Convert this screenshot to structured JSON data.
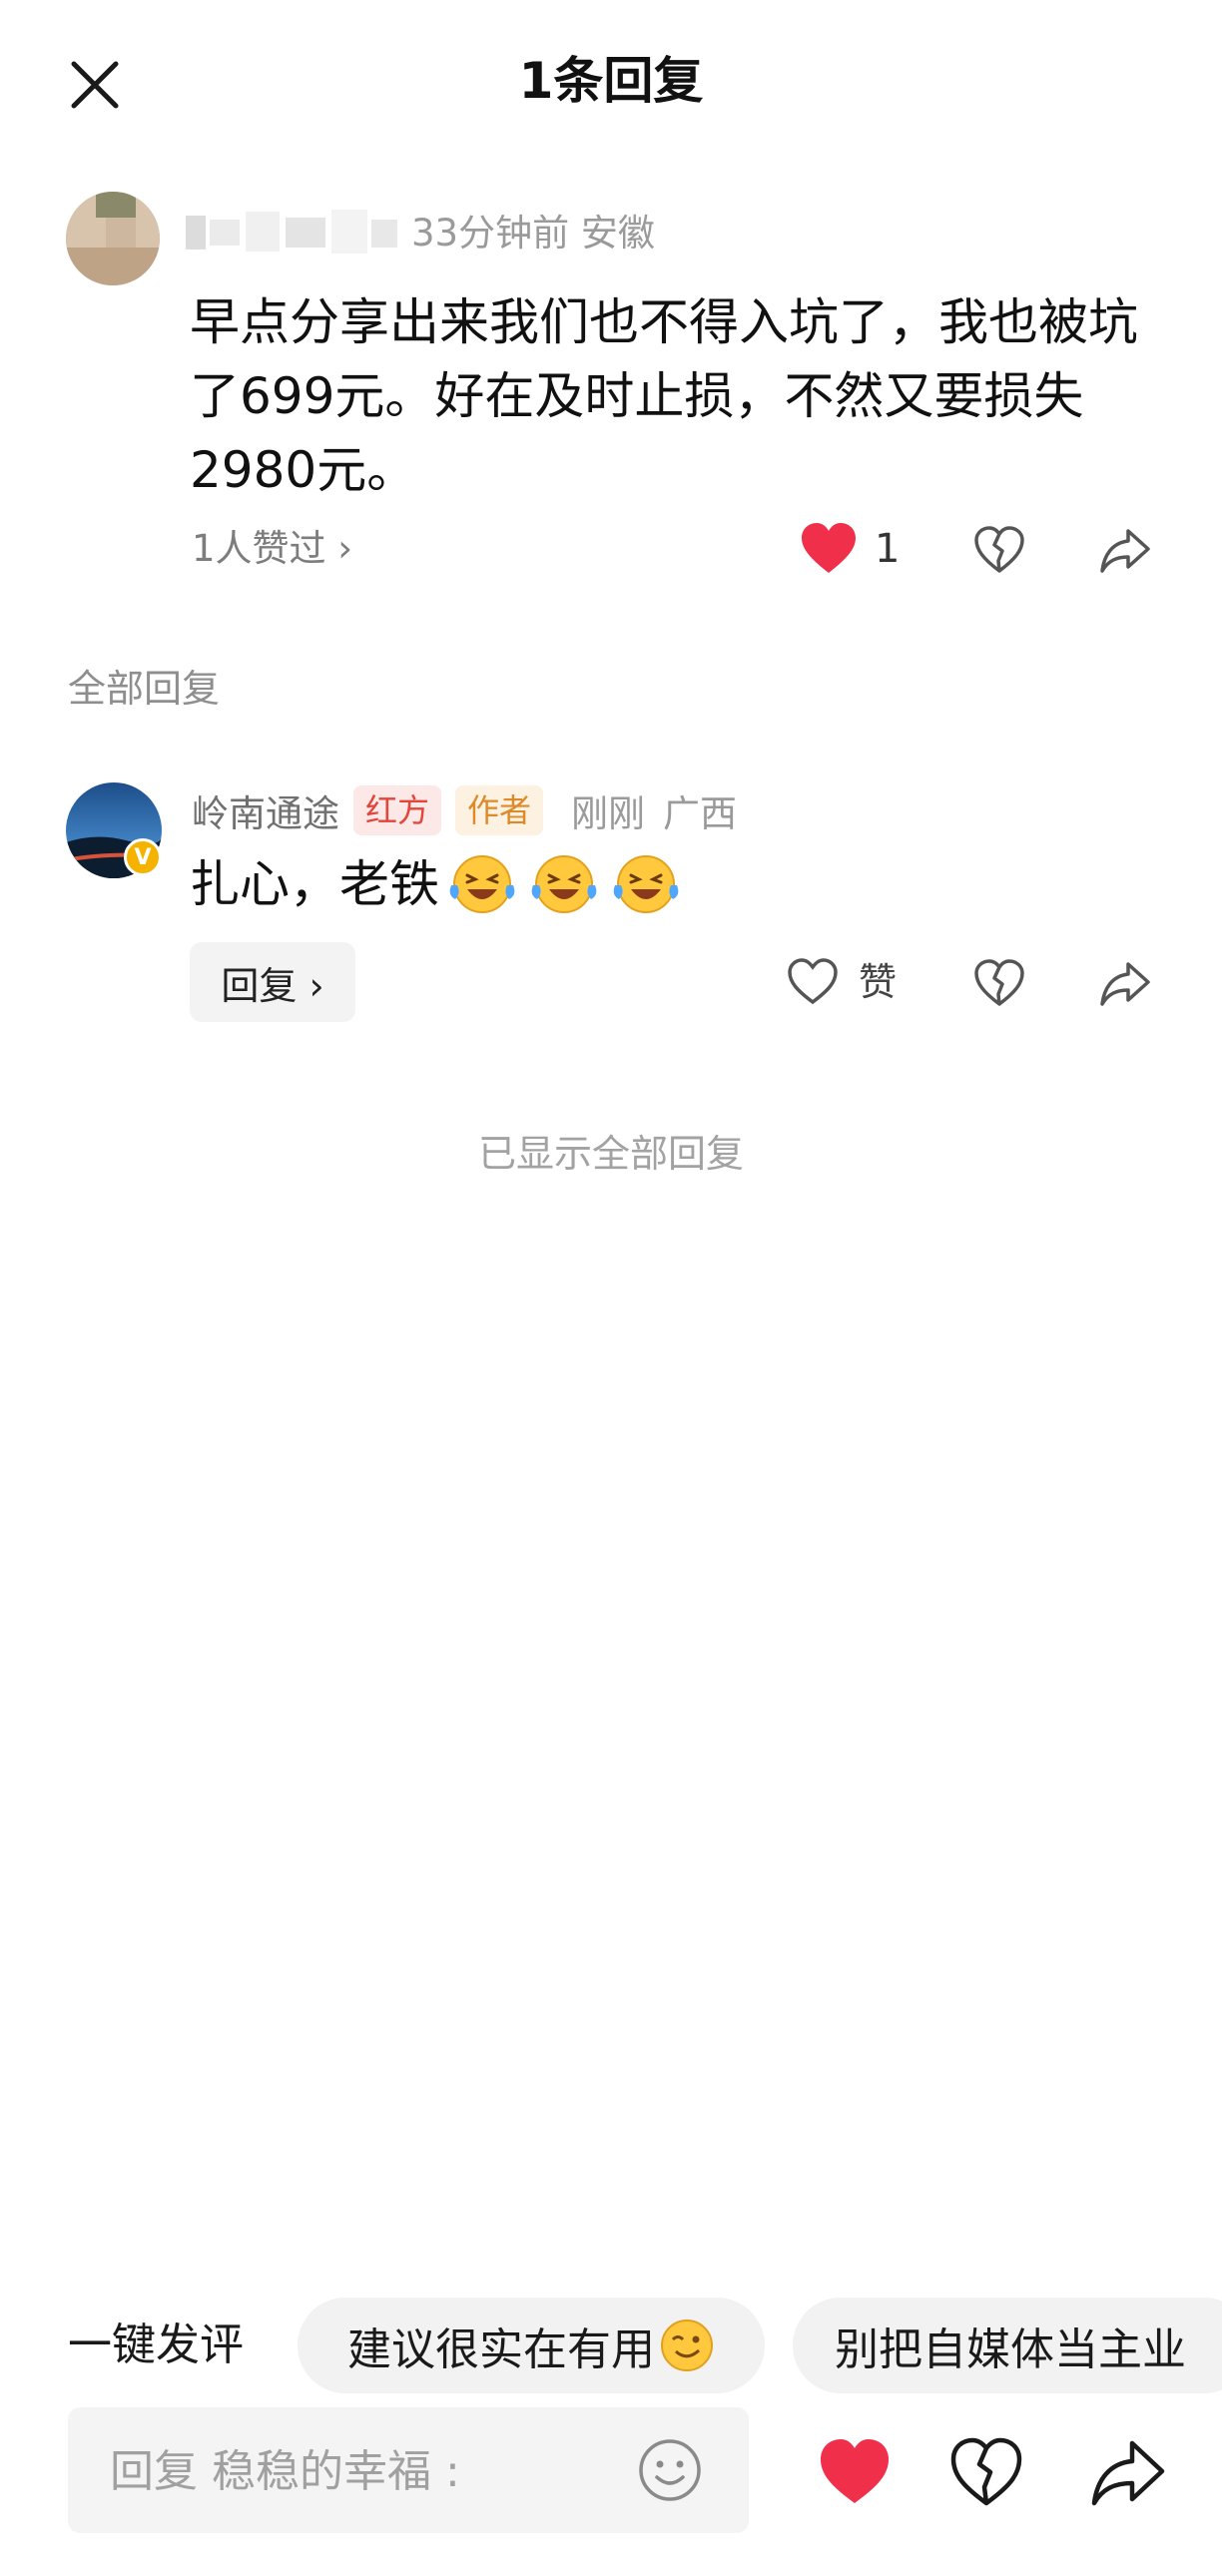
{
  "header": {
    "title": "1条回复",
    "close_icon": "close-icon"
  },
  "parent_comment": {
    "time_location": "33分钟前   安徽",
    "text": "早点分享出来我们也不得入坑了，我也被坑了699元。好在及时止损，不然又要损失2980元。",
    "likers_text": "1人赞过 ›",
    "like_count": "1",
    "like_color": "#f0304a"
  },
  "section_label": "全部回复",
  "reply": {
    "username": "岭南通途",
    "tag_team": "红方",
    "tag_author": "作者",
    "time": "刚刚",
    "location": "广西",
    "text": "扎心，老铁",
    "emoji": "laughing-tears-emoji",
    "emoji_count": 3,
    "reply_button": "回复 ›",
    "zan_label": "赞",
    "verified_badge": "V",
    "badge_color": "#f5b300"
  },
  "footer_note": "已显示全部回复",
  "quick_comment": {
    "label": "一键发评",
    "chips": [
      "建议很实在有用",
      "别把自媒体当主业"
    ]
  },
  "input": {
    "placeholder": "回复 稳稳的幸福 :"
  }
}
